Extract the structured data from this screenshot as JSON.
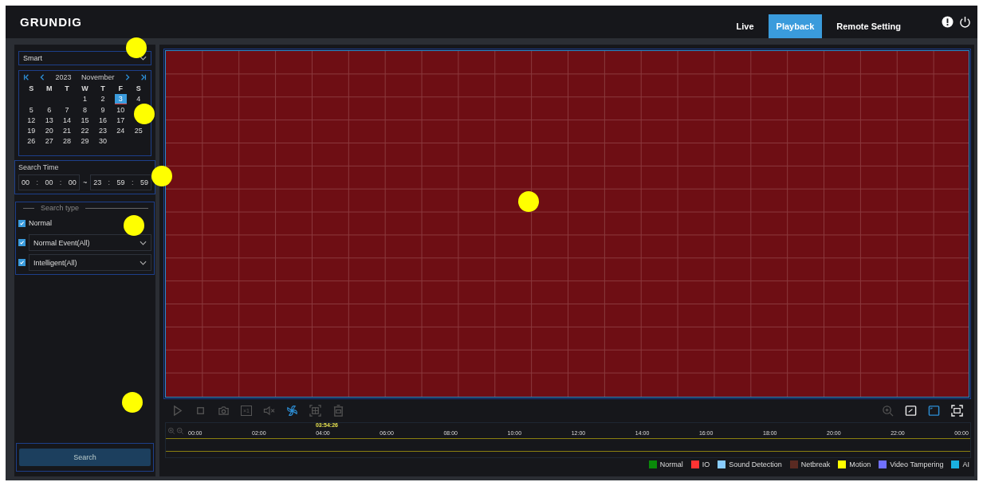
{
  "header": {
    "logo": "GRUNDIG",
    "tabs": [
      {
        "label": "Live",
        "selected": false
      },
      {
        "label": "Playback",
        "selected": true
      },
      {
        "label": "Remote Setting",
        "selected": false
      }
    ]
  },
  "sidebar": {
    "mode": "Smart",
    "calendar": {
      "year": "2023",
      "month": "November",
      "weekdays": [
        "S",
        "M",
        "T",
        "W",
        "T",
        "F",
        "S"
      ],
      "weeks": [
        [
          {
            "label": "1",
            "selected": false
          },
          {
            "label": "2",
            "selected": false
          },
          {
            "label": "3",
            "selected": true
          },
          {
            "label": "4",
            "selected": false
          }
        ],
        [
          {
            "label": "5",
            "selected": false
          },
          {
            "label": "6",
            "selected": false
          },
          {
            "label": "7",
            "selected": false
          },
          {
            "label": "8",
            "selected": false
          },
          {
            "label": "9",
            "selected": false
          },
          {
            "label": "10",
            "selected": false
          }
        ],
        [
          {
            "label": "12",
            "selected": false
          },
          {
            "label": "13",
            "selected": false
          },
          {
            "label": "14",
            "selected": false
          },
          {
            "label": "15",
            "selected": false
          },
          {
            "label": "16",
            "selected": false
          },
          {
            "label": "17",
            "selected": false
          }
        ],
        [
          {
            "label": "19",
            "selected": false
          },
          {
            "label": "20",
            "selected": false
          },
          {
            "label": "21",
            "selected": false
          },
          {
            "label": "22",
            "selected": false
          },
          {
            "label": "23",
            "selected": false
          },
          {
            "label": "24",
            "selected": false
          },
          {
            "label": "25",
            "selected": false
          }
        ],
        [
          {
            "label": "26",
            "selected": false
          },
          {
            "label": "27",
            "selected": false
          },
          {
            "label": "28",
            "selected": false
          },
          {
            "label": "29",
            "selected": false
          },
          {
            "label": "30",
            "selected": false
          }
        ]
      ]
    },
    "search_time": {
      "label": "Search Time",
      "start": [
        "00",
        "00",
        "00"
      ],
      "time_separator": ":",
      "separator": "~",
      "end": [
        "23",
        "59",
        "59"
      ]
    },
    "search_type": {
      "title": "Search type",
      "items": [
        {
          "kind": "checkbox",
          "label": "Normal",
          "checked": true
        },
        {
          "kind": "dropdown",
          "label": "Normal Event(All)",
          "checked": true
        },
        {
          "kind": "dropdown",
          "label": "Intelligent(All)",
          "checked": true
        }
      ]
    },
    "search_button": "Search"
  },
  "controls": [
    {
      "kind": "play",
      "active": false
    },
    {
      "kind": "stop",
      "active": false
    },
    {
      "kind": "snapshot",
      "active": false
    },
    {
      "kind": "speed",
      "label": "×1",
      "active": false
    },
    {
      "kind": "mute",
      "active": false
    },
    {
      "kind": "sync",
      "active": true
    },
    {
      "kind": "grid",
      "active": false
    },
    {
      "kind": "trash",
      "active": false
    }
  ],
  "view_controls": [
    {
      "kind": "zoom",
      "active": false
    },
    {
      "kind": "window",
      "active": false
    },
    {
      "kind": "fit",
      "active": true
    },
    {
      "kind": "fullscreen",
      "active": false
    }
  ],
  "timeline": {
    "cursor": {
      "time": "03:54:26",
      "level": 0.163
    },
    "ticks": [
      "00:00",
      "02:00",
      "04:00",
      "06:00",
      "08:00",
      "10:00",
      "12:00",
      "14:00",
      "16:00",
      "18:00",
      "20:00",
      "22:00",
      "00:00"
    ]
  },
  "legend": [
    {
      "label": "Normal",
      "color": "#0a8a0a"
    },
    {
      "label": "IO",
      "color": "#ff3333"
    },
    {
      "label": "Sound Detection",
      "color": "#88ccff"
    },
    {
      "label": "Netbreak",
      "color": "#5a2a22"
    },
    {
      "label": "Motion",
      "color": "#ffff00"
    },
    {
      "label": "Video Tampering",
      "color": "#7070ff"
    },
    {
      "label": "AI",
      "color": "#1ab0e0"
    }
  ]
}
